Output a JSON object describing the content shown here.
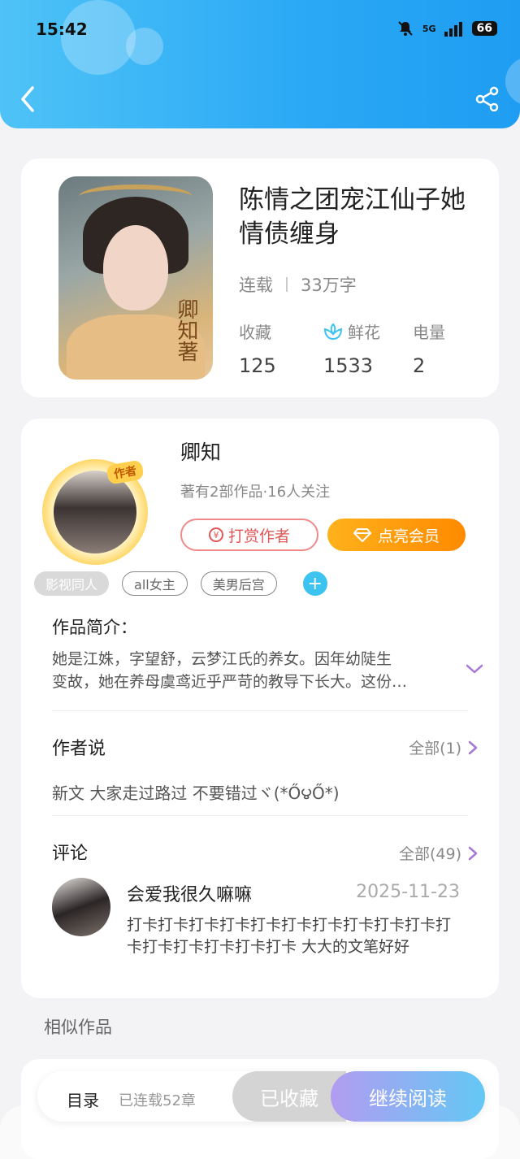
{
  "status_bar": {
    "time": "15:42",
    "signal": "5G",
    "battery": "66"
  },
  "colors": {
    "accent": "#2aa8f5",
    "vip": "#ff9a0a",
    "tip": "#e05757",
    "link_chevron": "#a777d6"
  },
  "book": {
    "title": "陈情之团宠江仙子她情债缠身",
    "status": "连载",
    "word_count": "33万字",
    "cover_text": "卿知著",
    "stats": [
      {
        "label": "收藏",
        "value": "125",
        "icon": ""
      },
      {
        "label": "鲜花",
        "value": "1533",
        "icon": "flower-icon"
      },
      {
        "label": "电量",
        "value": "2",
        "icon": ""
      }
    ]
  },
  "author": {
    "badge": "作者",
    "name": "卿知",
    "info": "著有2部作品·16人关注",
    "tip_label": "打赏作者",
    "vip_label": "点亮会员"
  },
  "tags": [
    "影视同人",
    "all女主",
    "美男后宫"
  ],
  "intro": {
    "label": "作品简介：",
    "line1": "她是江姝，字望舒，云梦江氏的养女。因年幼陡生",
    "line2": "变故，她在养母虞鸢近乎严苛的教导下长大。这份…"
  },
  "author_says": {
    "title": "作者说",
    "more": "全部(1)",
    "text": "新文 大家走过路过 不要错过ヾ(*Ő౪Ő*)"
  },
  "comments": {
    "title": "评论",
    "more": "全部(49)",
    "item": {
      "name": "会爱我很久嘛嘛",
      "date": "2025-11-23",
      "text": "打卡打卡打卡打卡打卡打卡打卡打卡打卡打卡打卡打卡打卡打卡打卡打卡 大大的文笔好好"
    }
  },
  "similar": {
    "title": "相似作品"
  },
  "bottom_bar": {
    "catalog": "目录",
    "chapters": "已连载52章",
    "collected": "已收藏",
    "read": "继续阅读"
  }
}
